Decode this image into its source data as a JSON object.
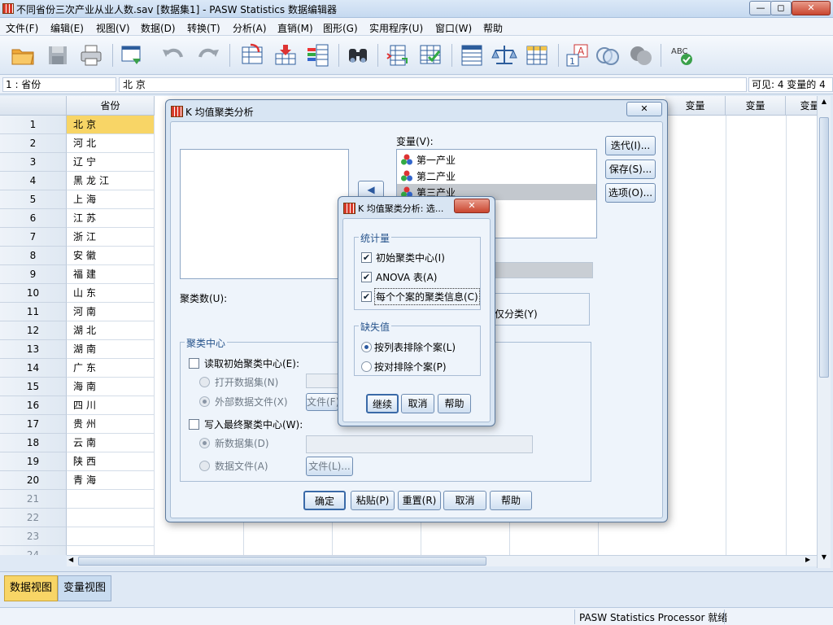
{
  "window": {
    "title": "不同省份三次产业从业人数.sav [数据集1] - PASW Statistics 数据编辑器",
    "min": "—",
    "restore": "◻",
    "close": "✕"
  },
  "menu": [
    "文件(F)",
    "编辑(E)",
    "视图(V)",
    "数据(D)",
    "转换(T)",
    "分析(A)",
    "直销(M)",
    "图形(G)",
    "实用程序(U)",
    "窗口(W)",
    "帮助"
  ],
  "cellbar": {
    "ref": "1 : 省份",
    "value": "北 京",
    "visible": "可见:  4 变量的 4"
  },
  "grid": {
    "col_header": "省份",
    "var_header": "变量",
    "rows": [
      {
        "n": "1",
        "v": "北京"
      },
      {
        "n": "2",
        "v": "河北"
      },
      {
        "n": "3",
        "v": "辽宁"
      },
      {
        "n": "4",
        "v": "黑龙江"
      },
      {
        "n": "5",
        "v": "上海"
      },
      {
        "n": "6",
        "v": "江苏"
      },
      {
        "n": "7",
        "v": "浙江"
      },
      {
        "n": "8",
        "v": "安徽"
      },
      {
        "n": "9",
        "v": "福建"
      },
      {
        "n": "10",
        "v": "山东"
      },
      {
        "n": "11",
        "v": "河南"
      },
      {
        "n": "12",
        "v": "湖北"
      },
      {
        "n": "13",
        "v": "湖南"
      },
      {
        "n": "14",
        "v": "广东"
      },
      {
        "n": "15",
        "v": "海南"
      },
      {
        "n": "16",
        "v": "四川"
      },
      {
        "n": "17",
        "v": "贵州"
      },
      {
        "n": "18",
        "v": "云南"
      },
      {
        "n": "19",
        "v": "陕西"
      },
      {
        "n": "20",
        "v": "青海"
      },
      {
        "n": "21",
        "v": ""
      },
      {
        "n": "22",
        "v": ""
      },
      {
        "n": "23",
        "v": ""
      },
      {
        "n": "24",
        "v": ""
      }
    ]
  },
  "tabs": {
    "data_view": "数据视图",
    "var_view": "变量视图"
  },
  "status": "PASW Statistics Processor 就绪",
  "kmeans": {
    "title": "K 均值聚类分析",
    "variables_label": "变量(V):",
    "variables": [
      "第一产业",
      "第二产业",
      "第三产业"
    ],
    "buttons_side": [
      "迭代(I)...",
      "保存(S)...",
      "选项(O)..."
    ],
    "clusters_label": "聚类数(U):",
    "classify_only": "仅分类(Y)",
    "centers_group": "聚类中心",
    "read_initial": "读取初始聚类中心(E):",
    "open_dataset": "打开数据集(N)",
    "external_file": "外部数据文件(X)",
    "file_btn": "文件(F)...",
    "write_final": "写入最终聚类中心(W):",
    "new_dataset": "新数据集(D)",
    "data_file": "数据文件(A)",
    "file_btn2": "文件(L)...",
    "bottom_buttons": [
      "确定",
      "粘贴(P)",
      "重置(R)",
      "取消",
      "帮助"
    ]
  },
  "options": {
    "title": "K 均值聚类分析: 选...",
    "stats_group": "统计量",
    "stats": [
      "初始聚类中心(I)",
      "ANOVA 表(A)",
      "每个个案的聚类信息(C)"
    ],
    "missing_group": "缺失值",
    "missing": [
      "按列表排除个案(L)",
      "按对排除个案(P)"
    ],
    "buttons": [
      "继续",
      "取消",
      "帮助"
    ]
  },
  "colors": {
    "accent": "#3a6aa8",
    "selected_cell": "#f8d566"
  }
}
